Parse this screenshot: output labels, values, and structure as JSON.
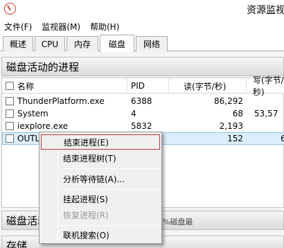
{
  "window": {
    "title": "资源监视"
  },
  "menubar": {
    "items": [
      "文件(F)",
      "监视器(M)",
      "帮助(H)"
    ]
  },
  "tabs": [
    {
      "label": "概述",
      "active": false
    },
    {
      "label": "CPU",
      "active": false
    },
    {
      "label": "内存",
      "active": false
    },
    {
      "label": "磁盘",
      "active": true
    },
    {
      "label": "网络",
      "active": false
    }
  ],
  "section": {
    "title": "磁盘活动的进程"
  },
  "table": {
    "columns": [
      "名称",
      "PID",
      "读(字节/秒)",
      "写(字节/秒)"
    ],
    "rows": [
      {
        "name": "ThunderPlatform.exe",
        "pid": "6388",
        "read": "86,292",
        "write": "",
        "checked": false,
        "selected": false
      },
      {
        "name": "System",
        "pid": "4",
        "read": "68",
        "write": "53,57",
        "checked": false,
        "selected": false
      },
      {
        "name": "iexplore.exe",
        "pid": "5832",
        "read": "2,193",
        "write": "",
        "checked": false,
        "selected": false
      },
      {
        "name": "OUTLO",
        "pid": "",
        "read": "152",
        "write": "6",
        "checked": false,
        "selected": true
      }
    ]
  },
  "bottom": {
    "section1_title": "磁盘活动",
    "section1_right": "%磁盘最",
    "section2_title": "存储"
  },
  "context_menu": {
    "items": [
      {
        "label": "结束进程(E)",
        "enabled": true,
        "highlighted": true
      },
      {
        "label": "结束进程树(T)",
        "enabled": true,
        "highlighted": false
      },
      {
        "label": "分析等待链(A)...",
        "enabled": true,
        "highlighted": false
      },
      {
        "label": "挂起进程(S)",
        "enabled": true,
        "highlighted": false
      },
      {
        "label": "恢复进程(R)",
        "enabled": false,
        "highlighted": false
      },
      {
        "label": "联机搜索(O)",
        "enabled": true,
        "highlighted": false
      }
    ]
  }
}
